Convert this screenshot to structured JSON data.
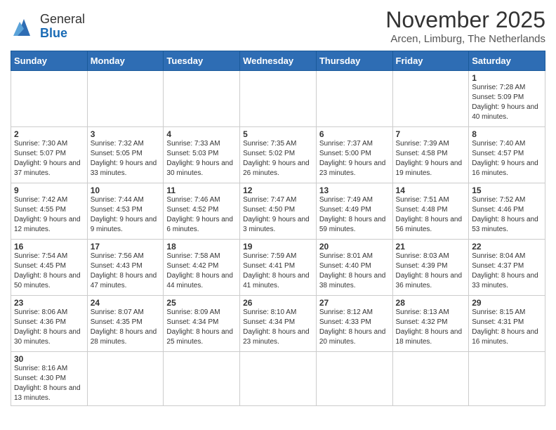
{
  "header": {
    "logo_text_normal": "General",
    "logo_text_blue": "Blue",
    "month_title": "November 2025",
    "location": "Arcen, Limburg, The Netherlands"
  },
  "weekdays": [
    "Sunday",
    "Monday",
    "Tuesday",
    "Wednesday",
    "Thursday",
    "Friday",
    "Saturday"
  ],
  "days": {
    "d1": {
      "num": "1",
      "sunrise": "7:28 AM",
      "sunset": "5:09 PM",
      "daylight": "9 hours and 40 minutes."
    },
    "d2": {
      "num": "2",
      "sunrise": "7:30 AM",
      "sunset": "5:07 PM",
      "daylight": "9 hours and 37 minutes."
    },
    "d3": {
      "num": "3",
      "sunrise": "7:32 AM",
      "sunset": "5:05 PM",
      "daylight": "9 hours and 33 minutes."
    },
    "d4": {
      "num": "4",
      "sunrise": "7:33 AM",
      "sunset": "5:03 PM",
      "daylight": "9 hours and 30 minutes."
    },
    "d5": {
      "num": "5",
      "sunrise": "7:35 AM",
      "sunset": "5:02 PM",
      "daylight": "9 hours and 26 minutes."
    },
    "d6": {
      "num": "6",
      "sunrise": "7:37 AM",
      "sunset": "5:00 PM",
      "daylight": "9 hours and 23 minutes."
    },
    "d7": {
      "num": "7",
      "sunrise": "7:39 AM",
      "sunset": "4:58 PM",
      "daylight": "9 hours and 19 minutes."
    },
    "d8": {
      "num": "8",
      "sunrise": "7:40 AM",
      "sunset": "4:57 PM",
      "daylight": "9 hours and 16 minutes."
    },
    "d9": {
      "num": "9",
      "sunrise": "7:42 AM",
      "sunset": "4:55 PM",
      "daylight": "9 hours and 12 minutes."
    },
    "d10": {
      "num": "10",
      "sunrise": "7:44 AM",
      "sunset": "4:53 PM",
      "daylight": "9 hours and 9 minutes."
    },
    "d11": {
      "num": "11",
      "sunrise": "7:46 AM",
      "sunset": "4:52 PM",
      "daylight": "9 hours and 6 minutes."
    },
    "d12": {
      "num": "12",
      "sunrise": "7:47 AM",
      "sunset": "4:50 PM",
      "daylight": "9 hours and 3 minutes."
    },
    "d13": {
      "num": "13",
      "sunrise": "7:49 AM",
      "sunset": "4:49 PM",
      "daylight": "8 hours and 59 minutes."
    },
    "d14": {
      "num": "14",
      "sunrise": "7:51 AM",
      "sunset": "4:48 PM",
      "daylight": "8 hours and 56 minutes."
    },
    "d15": {
      "num": "15",
      "sunrise": "7:52 AM",
      "sunset": "4:46 PM",
      "daylight": "8 hours and 53 minutes."
    },
    "d16": {
      "num": "16",
      "sunrise": "7:54 AM",
      "sunset": "4:45 PM",
      "daylight": "8 hours and 50 minutes."
    },
    "d17": {
      "num": "17",
      "sunrise": "7:56 AM",
      "sunset": "4:43 PM",
      "daylight": "8 hours and 47 minutes."
    },
    "d18": {
      "num": "18",
      "sunrise": "7:58 AM",
      "sunset": "4:42 PM",
      "daylight": "8 hours and 44 minutes."
    },
    "d19": {
      "num": "19",
      "sunrise": "7:59 AM",
      "sunset": "4:41 PM",
      "daylight": "8 hours and 41 minutes."
    },
    "d20": {
      "num": "20",
      "sunrise": "8:01 AM",
      "sunset": "4:40 PM",
      "daylight": "8 hours and 38 minutes."
    },
    "d21": {
      "num": "21",
      "sunrise": "8:03 AM",
      "sunset": "4:39 PM",
      "daylight": "8 hours and 36 minutes."
    },
    "d22": {
      "num": "22",
      "sunrise": "8:04 AM",
      "sunset": "4:37 PM",
      "daylight": "8 hours and 33 minutes."
    },
    "d23": {
      "num": "23",
      "sunrise": "8:06 AM",
      "sunset": "4:36 PM",
      "daylight": "8 hours and 30 minutes."
    },
    "d24": {
      "num": "24",
      "sunrise": "8:07 AM",
      "sunset": "4:35 PM",
      "daylight": "8 hours and 28 minutes."
    },
    "d25": {
      "num": "25",
      "sunrise": "8:09 AM",
      "sunset": "4:34 PM",
      "daylight": "8 hours and 25 minutes."
    },
    "d26": {
      "num": "26",
      "sunrise": "8:10 AM",
      "sunset": "4:34 PM",
      "daylight": "8 hours and 23 minutes."
    },
    "d27": {
      "num": "27",
      "sunrise": "8:12 AM",
      "sunset": "4:33 PM",
      "daylight": "8 hours and 20 minutes."
    },
    "d28": {
      "num": "28",
      "sunrise": "8:13 AM",
      "sunset": "4:32 PM",
      "daylight": "8 hours and 18 minutes."
    },
    "d29": {
      "num": "29",
      "sunrise": "8:15 AM",
      "sunset": "4:31 PM",
      "daylight": "8 hours and 16 minutes."
    },
    "d30": {
      "num": "30",
      "sunrise": "8:16 AM",
      "sunset": "4:30 PM",
      "daylight": "8 hours and 13 minutes."
    }
  }
}
